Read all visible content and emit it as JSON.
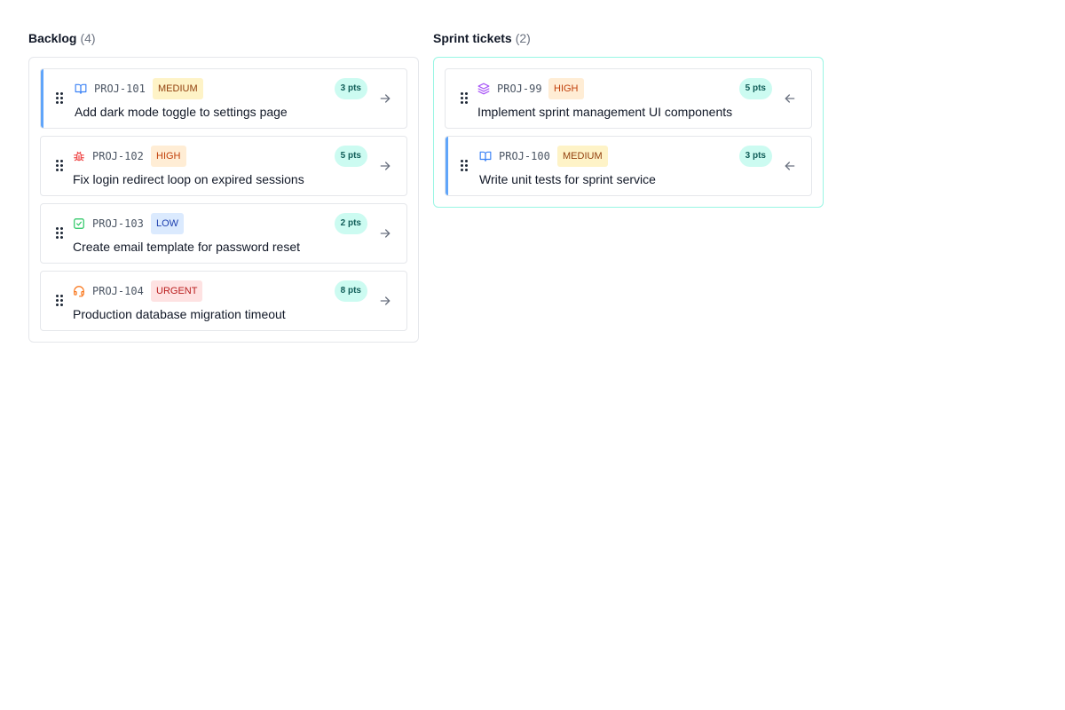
{
  "backlog": {
    "title": "Backlog",
    "count": "(4)",
    "tickets": [
      {
        "id": "PROJ-101",
        "priority": "MEDIUM",
        "title": "Add dark mode toggle to settings page",
        "points": "3 pts",
        "icon": "book-icon"
      },
      {
        "id": "PROJ-102",
        "priority": "HIGH",
        "title": "Fix login redirect loop on expired sessions",
        "points": "5 pts",
        "icon": "bug-icon"
      },
      {
        "id": "PROJ-103",
        "priority": "LOW",
        "title": "Create email template for password reset",
        "points": "2 pts",
        "icon": "check-square-icon"
      },
      {
        "id": "PROJ-104",
        "priority": "URGENT",
        "title": "Production database migration timeout",
        "points": "8 pts",
        "icon": "headset-icon"
      }
    ]
  },
  "sprint": {
    "title": "Sprint tickets",
    "count": "(2)",
    "tickets": [
      {
        "id": "PROJ-99",
        "priority": "HIGH",
        "title": "Implement sprint management UI components",
        "points": "5 pts",
        "icon": "layers-icon"
      },
      {
        "id": "PROJ-100",
        "priority": "MEDIUM",
        "title": "Write unit tests for sprint service",
        "points": "3 pts",
        "icon": "book-icon"
      }
    ]
  },
  "colors": {
    "accent_border": "#60a5fa",
    "sprint_border": "#99f6e4",
    "points_bg": "#ccfbf1",
    "priority_medium": "#fef3c7",
    "priority_high": "#ffedd5",
    "priority_low": "#dbeafe",
    "priority_urgent": "#fee2e2"
  }
}
